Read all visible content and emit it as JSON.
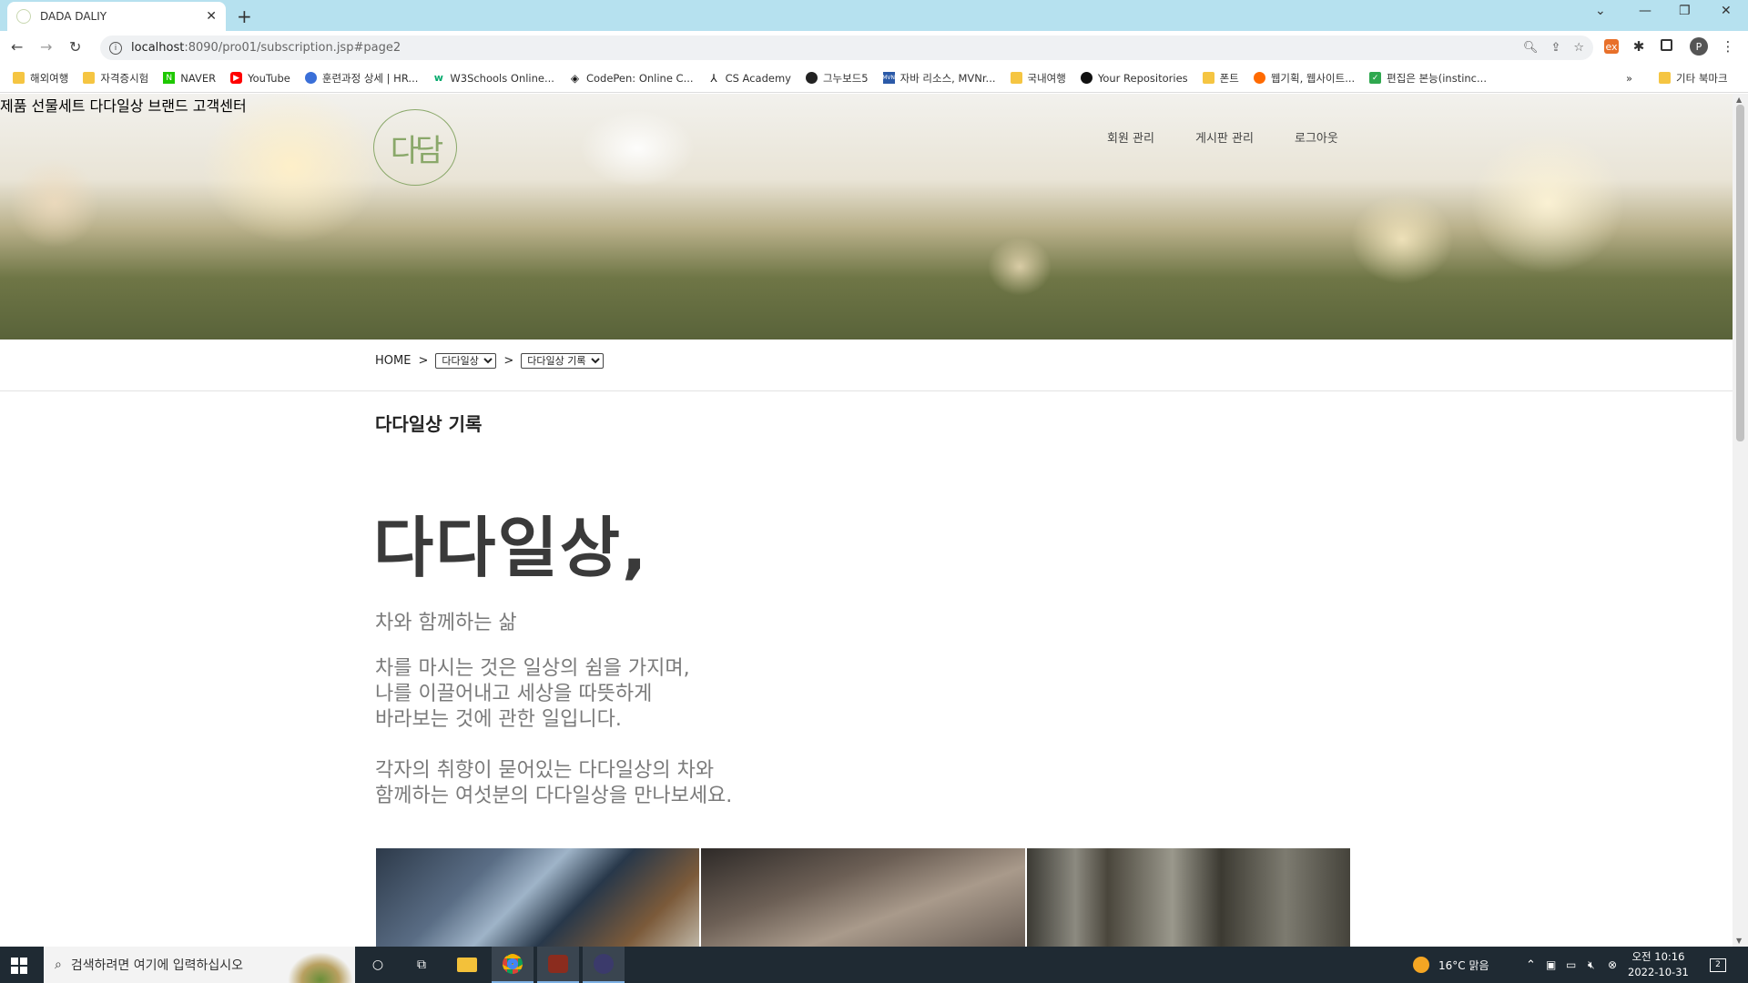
{
  "browser": {
    "tab_title": "DADA DALIY",
    "url_host": "localhost",
    "url_rest": ":8090/pro01/subscription.jsp#page2",
    "profile_initial": "P",
    "bookmarks": [
      "해외여행",
      "자격증시험",
      "NAVER",
      "YouTube",
      "훈련과정 상세 | HR...",
      "W3Schools Online...",
      "CodePen: Online C...",
      "CS Academy",
      "그누보드5",
      "자바 리소스, MVNr...",
      "국내여행",
      "Your Repositories",
      "폰트",
      "웹기획, 웹사이트...",
      "편집은 본능(instinc..."
    ],
    "bookmarks_more": "»",
    "other_bookmarks": "기타 북마크"
  },
  "site": {
    "logo_text": "다담",
    "nav": [
      "제품",
      "선물세트",
      "다다일상",
      "브랜드",
      "고객센터"
    ],
    "admin_nav": [
      "회원 관리",
      "게시판 관리",
      "로그아웃"
    ],
    "breadcrumb": {
      "home": "HOME",
      "sep": ">",
      "select1": "다다일상",
      "select2": "다다일상 기록"
    },
    "section_title": "다다일상 기록",
    "headline": "다다일상,",
    "lead": "차와 함께하는 삶",
    "paragraph1": [
      "차를 마시는 것은 일상의 쉼을 가지며,",
      "나를 이끌어내고 세상을 따뜻하게",
      "바라보는 것에 관한 일입니다."
    ],
    "paragraph2": [
      "각자의 취향이 묻어있는 다다일상의 차와",
      "함께하는 여섯분의 다다일상을 만나보세요."
    ]
  },
  "taskbar": {
    "search_placeholder": "검색하려면 여기에 입력하십시오",
    "weather": "16°C  맑음",
    "time_ampm": "오전 10:16",
    "date": "2022-10-31",
    "notification_count": "2"
  },
  "colors": {
    "tabbar": "#b6e1ef",
    "logo_green": "#8aa86a",
    "taskbar": "#1f2a33"
  }
}
